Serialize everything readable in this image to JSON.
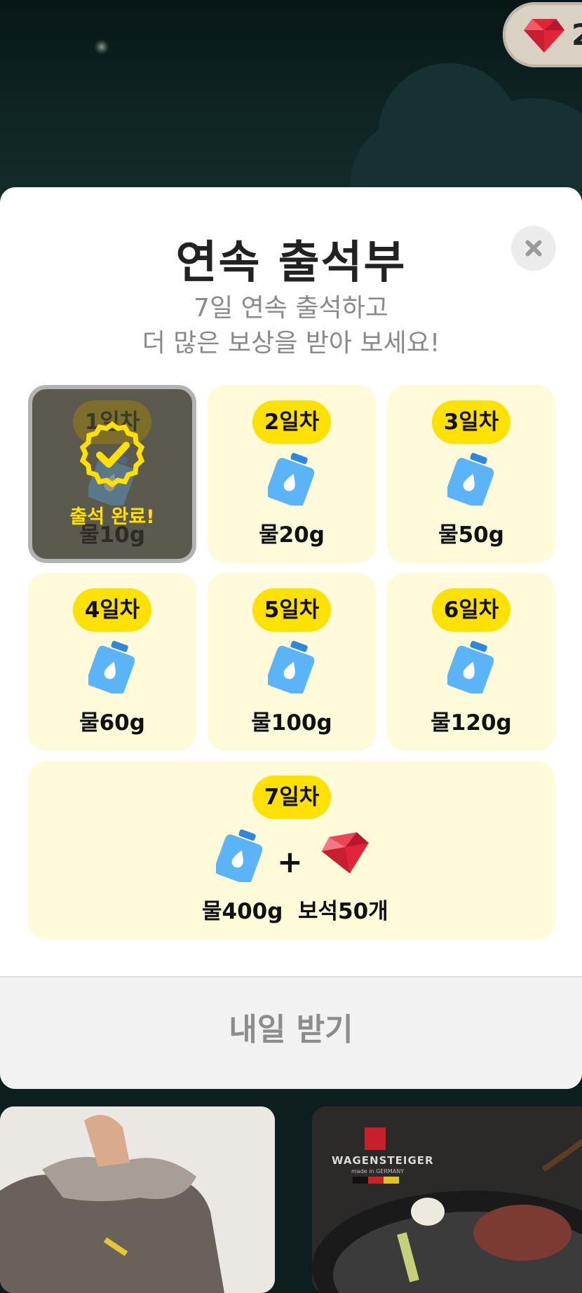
{
  "header": {
    "gem_count": "2"
  },
  "modal": {
    "title": "연속 출석부",
    "subtitle_line1": "7일 연속 출석하고",
    "subtitle_line2": "더 많은 보상을 받아 보세요!",
    "close_icon": "close-icon"
  },
  "days": [
    {
      "label": "1일차",
      "reward": "물10g",
      "status": "출석 완료!"
    },
    {
      "label": "2일차",
      "reward": "물20g"
    },
    {
      "label": "3일차",
      "reward": "물50g"
    },
    {
      "label": "4일차",
      "reward": "물60g"
    },
    {
      "label": "5일차",
      "reward": "물100g"
    },
    {
      "label": "6일차",
      "reward": "물120g"
    },
    {
      "label": "7일차",
      "reward_water": "물400g",
      "plus": "+",
      "reward_gem": "보석50개"
    }
  ],
  "footer": {
    "button_label": "내일 받기"
  },
  "banners": {
    "right_brand": "WAGENSTEIGER",
    "right_brand_sub": "made in GERMANY"
  },
  "colors": {
    "badge": "#ffe100",
    "card": "#fefada",
    "footer_text": "#8c8c8c"
  }
}
